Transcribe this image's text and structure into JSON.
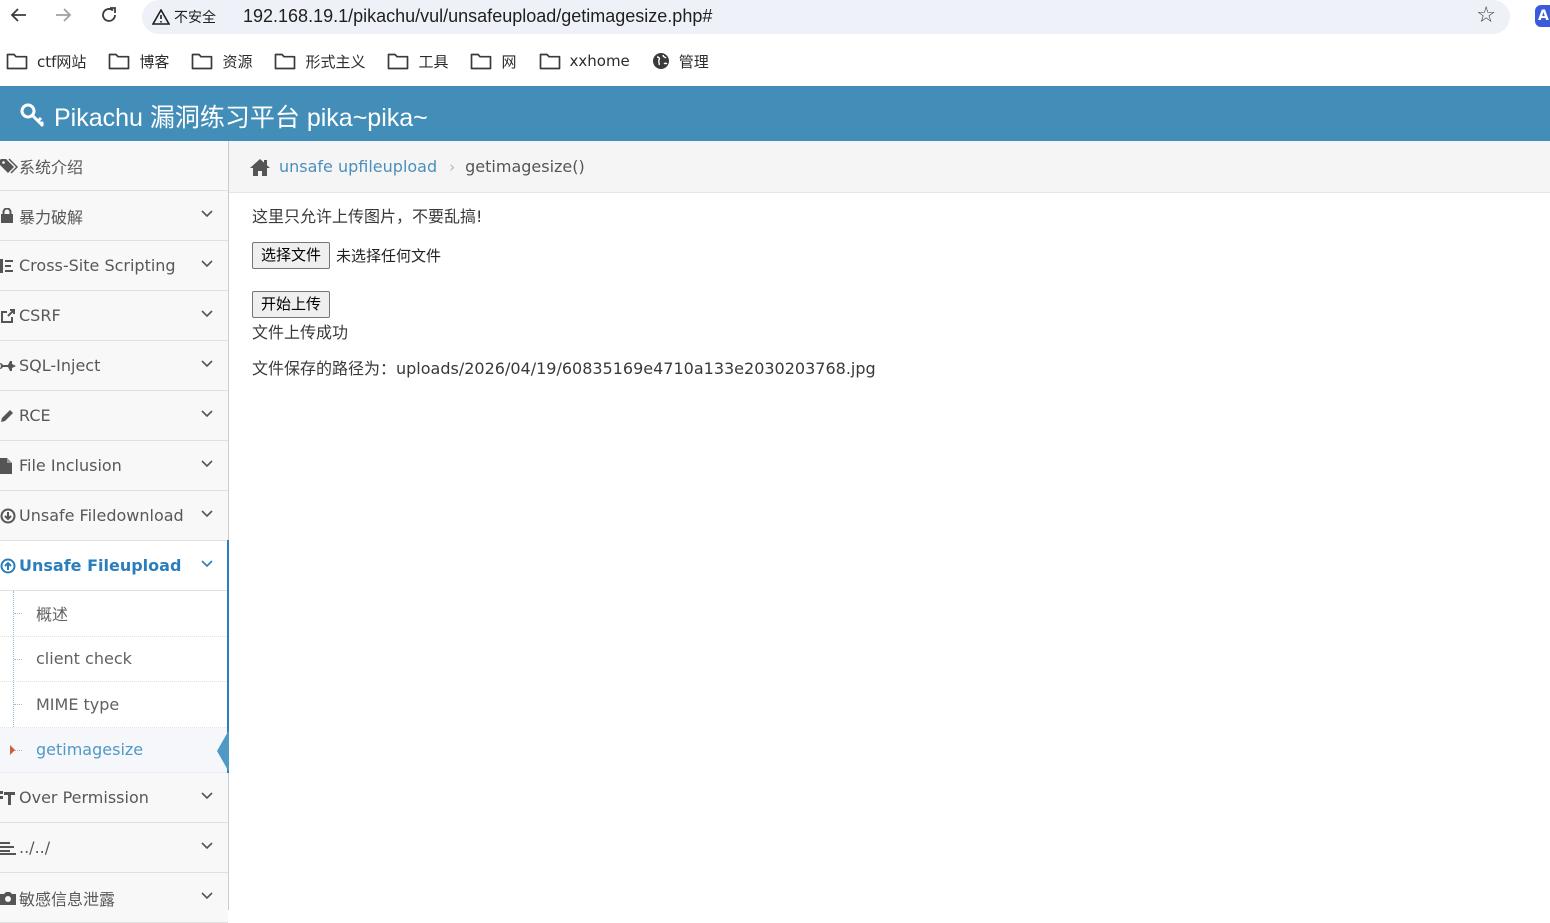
{
  "browser": {
    "security_label": "不安全",
    "url": "192.168.19.1/pikachu/vul/unsafeupload/getimagesize.php#",
    "extension_letter": "A"
  },
  "bookmarks": [
    {
      "label": "ctf网站",
      "icon": "folder-icon"
    },
    {
      "label": "博客",
      "icon": "folder-icon"
    },
    {
      "label": "资源",
      "icon": "folder-icon"
    },
    {
      "label": "形式主义",
      "icon": "folder-icon"
    },
    {
      "label": "工具",
      "icon": "folder-icon"
    },
    {
      "label": "网",
      "icon": "folder-icon"
    },
    {
      "label": "xxhome",
      "icon": "folder-icon"
    },
    {
      "label": "管理",
      "icon": "globe-icon"
    }
  ],
  "header": {
    "title": "Pikachu 漏洞练习平台 pika~pika~",
    "icon": "key-icon"
  },
  "sidebar": {
    "items": [
      {
        "label": "系统介绍",
        "icon": "tags-icon",
        "has_children": false
      },
      {
        "label": "暴力破解",
        "icon": "lock-icon",
        "has_children": true
      },
      {
        "label": "Cross-Site Scripting",
        "icon": "list-icon",
        "has_children": true
      },
      {
        "label": "CSRF",
        "icon": "share-icon",
        "has_children": true
      },
      {
        "label": "SQL-Inject",
        "icon": "plane-icon",
        "has_children": true
      },
      {
        "label": "RCE",
        "icon": "pencil-icon",
        "has_children": true
      },
      {
        "label": "File Inclusion",
        "icon": "file-icon",
        "has_children": true
      },
      {
        "label": "Unsafe Filedownload",
        "icon": "download-icon",
        "has_children": true
      },
      {
        "label": "Unsafe Fileupload",
        "icon": "upload-icon",
        "has_children": true,
        "active": true
      },
      {
        "label": "Over Permission",
        "icon": "text-icon",
        "has_children": true
      },
      {
        "label": "../../",
        "icon": "align-icon",
        "has_children": true
      },
      {
        "label": "敏感信息泄露",
        "icon": "camera-icon",
        "has_children": true
      }
    ],
    "submenu": [
      {
        "label": "概述"
      },
      {
        "label": "client check"
      },
      {
        "label": "MIME type"
      },
      {
        "label": "getimagesize",
        "current": true
      }
    ]
  },
  "breadcrumb": {
    "parent": "unsafe upfileupload",
    "current": "getimagesize()"
  },
  "main": {
    "notice": "这里只允许上传图片，不要乱搞!",
    "choose_file_label": "选择文件",
    "no_file_label": "未选择任何文件",
    "submit_label": "开始上传",
    "result": "文件上传成功",
    "path_text": "文件保存的路径为：uploads/2026/04/19/60835169e4710a133e2030203768.jpg"
  },
  "colors": {
    "header_bg": "#438eb9",
    "active_blue": "#2b7dbc",
    "link_blue": "#4c8fbd",
    "caret_orange": "#c86139"
  }
}
